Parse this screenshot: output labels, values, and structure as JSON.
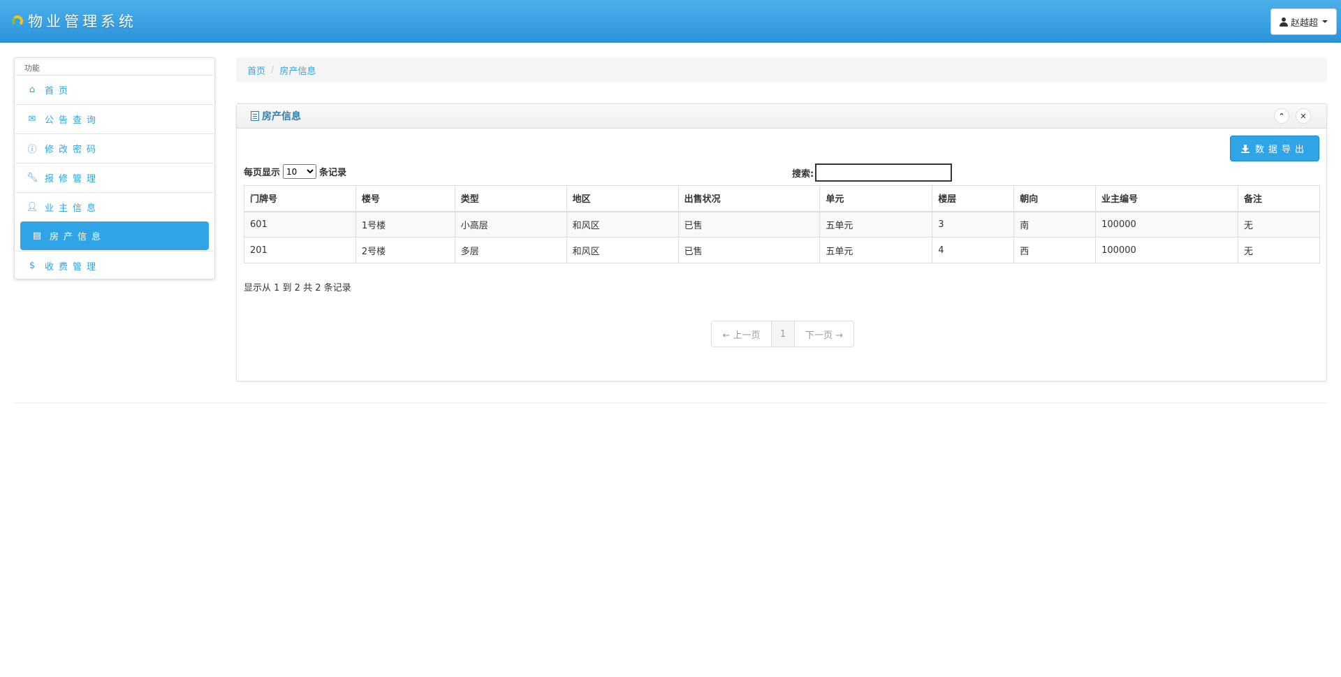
{
  "app": {
    "title": "物业管理系统",
    "user_name": "赵越超"
  },
  "sidebar": {
    "header": "功能",
    "items": [
      {
        "label": "首页",
        "icon": "home-icon"
      },
      {
        "label": "公告查询",
        "icon": "envelope-icon"
      },
      {
        "label": "修改密码",
        "icon": "info-icon"
      },
      {
        "label": "报修管理",
        "icon": "wrench-icon"
      },
      {
        "label": "业主信息",
        "icon": "user-icon"
      },
      {
        "label": "房产信息",
        "icon": "list-icon",
        "active": true
      },
      {
        "label": "收费管理",
        "icon": "dollar-icon"
      }
    ]
  },
  "breadcrumb": {
    "home": "首页",
    "current": "房产信息"
  },
  "panel": {
    "title": "房产信息",
    "export_label": "数据导出",
    "length_prefix": "每页显示",
    "length_value": "10",
    "length_suffix": "条记录",
    "search_label": "搜索:",
    "search_value": ""
  },
  "table": {
    "columns": [
      "门牌号",
      "楼号",
      "类型",
      "地区",
      "出售状况",
      "单元",
      "楼层",
      "朝向",
      "业主编号",
      "备注"
    ],
    "rows": [
      [
        "601",
        "1号楼",
        "小高层",
        "和风区",
        "已售",
        "五单元",
        "3",
        "南",
        "100000",
        "无"
      ],
      [
        "201",
        "2号楼",
        "多层",
        "和风区",
        "已售",
        "五单元",
        "4",
        "西",
        "100000",
        "无"
      ]
    ]
  },
  "info_text": "显示从 1 到 2 共 2 条记录",
  "pagination": {
    "prev": "← 上一页",
    "current": "1",
    "next": "下一页 →"
  },
  "colors": {
    "accent": "#2fa4e7",
    "panel_title": "#317eac"
  }
}
